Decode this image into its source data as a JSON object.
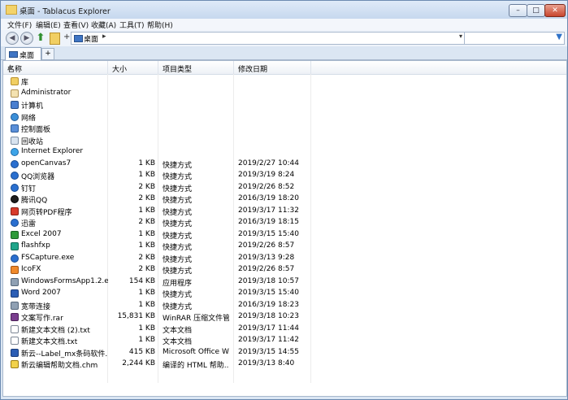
{
  "window": {
    "title": "桌面 - Tablacus Explorer"
  },
  "window_controls": {
    "minimize": "–",
    "maximize": "□",
    "close": "✕"
  },
  "menu": [
    "文件(F)",
    "编辑(E)",
    "查看(V)",
    "收藏(A)",
    "工具(T)",
    "帮助(H)"
  ],
  "nav": {
    "back": "◀",
    "forward": "▶",
    "up": "⬆",
    "plus": "+"
  },
  "address": {
    "location": "桌面",
    "arrow": "▸",
    "dropdown": "▾"
  },
  "search": {
    "value": "",
    "filter_icon": "▼"
  },
  "tabs": {
    "active": "桌面",
    "add": "+"
  },
  "columns": {
    "name": "名称",
    "size": "大小",
    "type": "项目类型",
    "date": "修改日期",
    "sort_arrow": "▲"
  },
  "files": [
    {
      "name": "库",
      "size": "",
      "type": "",
      "date": "",
      "icon": "library-folder-icon",
      "cls": "i-folder"
    },
    {
      "name": "Administrator",
      "size": "",
      "type": "",
      "date": "",
      "icon": "user-folder-icon",
      "cls": "i-user"
    },
    {
      "name": "计算机",
      "size": "",
      "type": "",
      "date": "",
      "icon": "computer-icon",
      "cls": "i-pc"
    },
    {
      "name": "网络",
      "size": "",
      "type": "",
      "date": "",
      "icon": "network-icon",
      "cls": "i-net"
    },
    {
      "name": "控制面板",
      "size": "",
      "type": "",
      "date": "",
      "icon": "control-panel-icon",
      "cls": "i-panel"
    },
    {
      "name": "回收站",
      "size": "",
      "type": "",
      "date": "",
      "icon": "recycle-bin-icon",
      "cls": "i-bin"
    },
    {
      "name": "Internet Explorer",
      "size": "",
      "type": "",
      "date": "",
      "icon": "internet-explorer-icon",
      "cls": "i-ie"
    },
    {
      "name": "openCanvas7",
      "size": "1 KB",
      "type": "快捷方式",
      "date": "2019/2/27 10:44",
      "icon": "opencanvas-icon",
      "cls": "i-lnk-blue"
    },
    {
      "name": "QQ浏览器",
      "size": "1 KB",
      "type": "快捷方式",
      "date": "2019/3/19 8:24",
      "icon": "qq-browser-icon",
      "cls": "i-lnk-blue"
    },
    {
      "name": "钉钉",
      "size": "2 KB",
      "type": "快捷方式",
      "date": "2019/2/26 8:52",
      "icon": "dingtalk-icon",
      "cls": "i-lnk-blue"
    },
    {
      "name": "腾讯QQ",
      "size": "2 KB",
      "type": "快捷方式",
      "date": "2016/3/19 18:20",
      "icon": "qq-icon",
      "cls": "i-qq"
    },
    {
      "name": "网页转PDF程序",
      "size": "1 KB",
      "type": "快捷方式",
      "date": "2019/3/17 11:32",
      "icon": "pdf-converter-icon",
      "cls": "i-red"
    },
    {
      "name": "迅雷",
      "size": "2 KB",
      "type": "快捷方式",
      "date": "2016/3/19 18:15",
      "icon": "xunlei-icon",
      "cls": "i-lnk-blue"
    },
    {
      "name": "Excel 2007",
      "size": "1 KB",
      "type": "快捷方式",
      "date": "2019/3/15 15:40",
      "icon": "excel-icon",
      "cls": "i-green"
    },
    {
      "name": "flashfxp",
      "size": "1 KB",
      "type": "快捷方式",
      "date": "2019/2/26 8:57",
      "icon": "flashfxp-icon",
      "cls": "i-teal"
    },
    {
      "name": "FSCapture.exe",
      "size": "2 KB",
      "type": "快捷方式",
      "date": "2019/3/13 9:28",
      "icon": "fscapture-icon",
      "cls": "i-lnk-blue"
    },
    {
      "name": "IcoFX",
      "size": "2 KB",
      "type": "快捷方式",
      "date": "2019/2/26 8:57",
      "icon": "icofx-icon",
      "cls": "i-orange"
    },
    {
      "name": "WindowsFormsApp1.2.e...",
      "size": "154 KB",
      "type": "应用程序",
      "date": "2019/3/18 10:57",
      "icon": "application-icon",
      "cls": "i-gray"
    },
    {
      "name": "Word 2007",
      "size": "1 KB",
      "type": "快捷方式",
      "date": "2019/3/15 15:40",
      "icon": "word-icon",
      "cls": "i-word"
    },
    {
      "name": "宽带连接",
      "size": "1 KB",
      "type": "快捷方式",
      "date": "2016/3/19 18:23",
      "icon": "broadband-icon",
      "cls": "i-gray"
    },
    {
      "name": "文案写作.rar",
      "size": "15,831 KB",
      "type": "WinRAR 压缩文件管...",
      "date": "2019/3/18 10:23",
      "icon": "rar-archive-icon",
      "cls": "i-rar"
    },
    {
      "name": "新建文本文档 (2).txt",
      "size": "1 KB",
      "type": "文本文档",
      "date": "2019/3/17 11:44",
      "icon": "text-file-icon",
      "cls": "i-txt"
    },
    {
      "name": "新建文本文档.txt",
      "size": "1 KB",
      "type": "文本文档",
      "date": "2019/3/17 11:42",
      "icon": "text-file-icon",
      "cls": "i-txt"
    },
    {
      "name": "新云--Label_mx条码软件...",
      "size": "415 KB",
      "type": "Microsoft Office W...",
      "date": "2019/3/15 14:55",
      "icon": "word-document-icon",
      "cls": "i-word"
    },
    {
      "name": "新云编辑帮助文档.chm",
      "size": "2,244 KB",
      "type": "编译的 HTML 帮助...",
      "date": "2019/3/13 8:40",
      "icon": "chm-help-icon",
      "cls": "i-chm"
    }
  ]
}
